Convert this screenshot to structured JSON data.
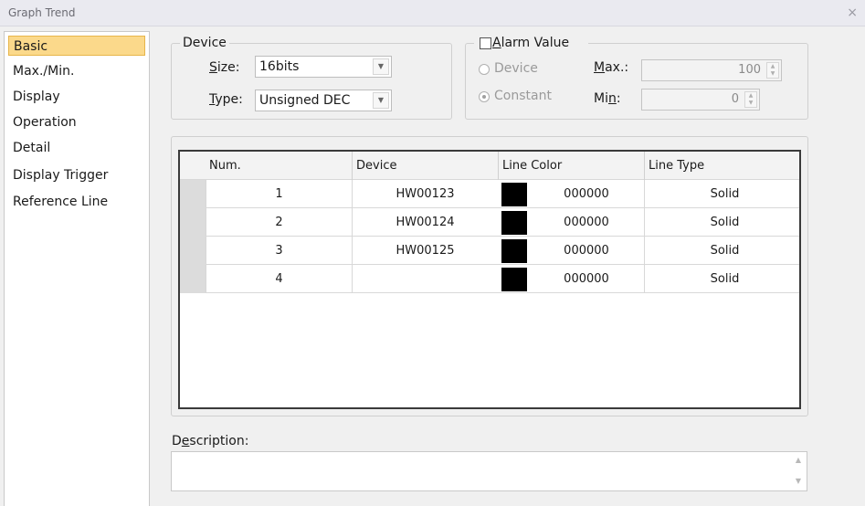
{
  "window": {
    "title": "Graph Trend",
    "close_glyph": "×"
  },
  "sidebar": {
    "items": [
      {
        "label": "Basic",
        "selected": true
      },
      {
        "label": "Max./Min.",
        "selected": false
      },
      {
        "label": "Display",
        "selected": false
      },
      {
        "label": "Operation",
        "selected": false
      },
      {
        "label": "Detail",
        "selected": false
      },
      {
        "label": "Display Trigger",
        "selected": false
      },
      {
        "label": "Reference Line",
        "selected": false
      }
    ]
  },
  "device": {
    "legend": "Device",
    "size_label": "Size:",
    "size_value": "16bits",
    "type_label": "Type:",
    "type_value": "Unsigned DEC"
  },
  "alarm": {
    "legend": "Alarm Value",
    "checked": false,
    "device_label": "Device",
    "constant_label": "Constant",
    "max_label": "Max.:",
    "max_value": "100",
    "min_label": "Min:",
    "min_value": "0"
  },
  "table": {
    "columns": [
      "Num.",
      "Device",
      "Line Color",
      "Line Type"
    ],
    "rows": [
      {
        "num": "1",
        "device": "HW00123",
        "color": "000000",
        "type": "Solid"
      },
      {
        "num": "2",
        "device": "HW00124",
        "color": "000000",
        "type": "Solid"
      },
      {
        "num": "3",
        "device": "HW00125",
        "color": "000000",
        "type": "Solid"
      },
      {
        "num": "4",
        "device": "",
        "color": "000000",
        "type": "Solid"
      }
    ],
    "swatch_color": "#000000"
  },
  "description": {
    "label": "Description:",
    "value": ""
  }
}
